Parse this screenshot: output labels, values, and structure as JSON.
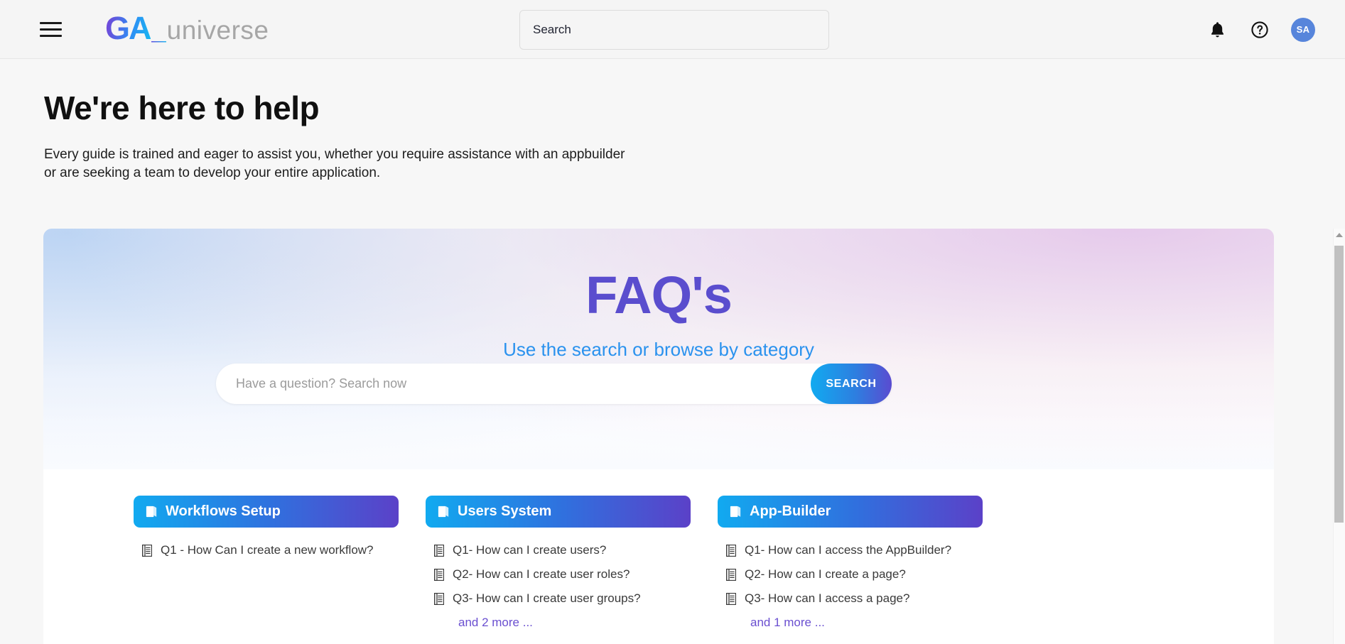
{
  "header": {
    "menu_icon": "hamburger-icon",
    "logo": {
      "mark": "GA",
      "underscore": "_",
      "word": "universe"
    },
    "search": {
      "value": "Search",
      "placeholder": "Search"
    },
    "notifications_icon": "bell-icon",
    "help_icon": "question-circle-icon",
    "avatar_initials": "SA"
  },
  "page": {
    "title": "We're here to help",
    "subtitle": "Every guide is trained and eager to assist you, whether you require assistance with an appbuilder or are seeking a team to develop your entire application."
  },
  "faq": {
    "title": "FAQ's",
    "subtitle": "Use the search or browse by category",
    "search_placeholder": "Have a question? Search now",
    "search_value": "",
    "search_button": "SEARCH",
    "categories": [
      {
        "name": "Workflows Setup",
        "icon": "book-icon",
        "questions": [
          "Q1 - How Can I create a new workflow?"
        ],
        "more_label": ""
      },
      {
        "name": "Users System",
        "icon": "book-icon",
        "questions": [
          "Q1- How can I create users?",
          "Q2- How can I create user roles?",
          "Q3- How can I create user groups?"
        ],
        "more_label": "and 2 more ..."
      },
      {
        "name": "App-Builder",
        "icon": "book-icon",
        "questions": [
          "Q1- How can I access the AppBuilder?",
          "Q2- How can I create a page?",
          "Q3- How can I access a page?"
        ],
        "more_label": "and 1 more ..."
      }
    ]
  },
  "colors": {
    "faq_title": "#5a4dce",
    "faq_subtitle": "#2a92ee",
    "accent_blue": "#11aaf0",
    "accent_purple": "#5b41c8",
    "avatar_bg": "#5785db",
    "more_link": "#6a4fd0"
  }
}
